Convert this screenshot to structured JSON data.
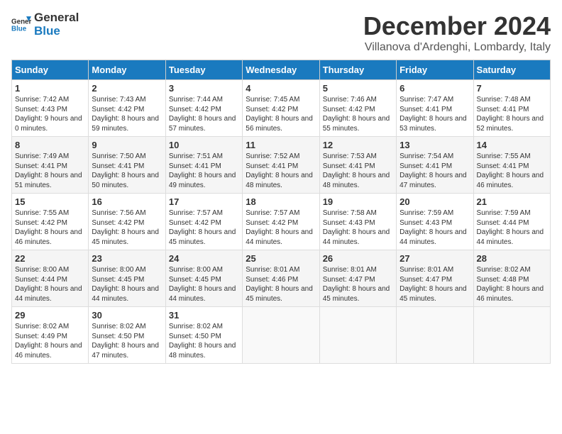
{
  "header": {
    "logo_general": "General",
    "logo_blue": "Blue",
    "title": "December 2024",
    "location": "Villanova d'Ardenghi, Lombardy, Italy"
  },
  "days_of_week": [
    "Sunday",
    "Monday",
    "Tuesday",
    "Wednesday",
    "Thursday",
    "Friday",
    "Saturday"
  ],
  "weeks": [
    [
      {
        "day": "1",
        "sunrise": "7:42 AM",
        "sunset": "4:43 PM",
        "daylight": "9 hours and 0 minutes."
      },
      {
        "day": "2",
        "sunrise": "7:43 AM",
        "sunset": "4:42 PM",
        "daylight": "8 hours and 59 minutes."
      },
      {
        "day": "3",
        "sunrise": "7:44 AM",
        "sunset": "4:42 PM",
        "daylight": "8 hours and 57 minutes."
      },
      {
        "day": "4",
        "sunrise": "7:45 AM",
        "sunset": "4:42 PM",
        "daylight": "8 hours and 56 minutes."
      },
      {
        "day": "5",
        "sunrise": "7:46 AM",
        "sunset": "4:42 PM",
        "daylight": "8 hours and 55 minutes."
      },
      {
        "day": "6",
        "sunrise": "7:47 AM",
        "sunset": "4:41 PM",
        "daylight": "8 hours and 53 minutes."
      },
      {
        "day": "7",
        "sunrise": "7:48 AM",
        "sunset": "4:41 PM",
        "daylight": "8 hours and 52 minutes."
      }
    ],
    [
      {
        "day": "8",
        "sunrise": "7:49 AM",
        "sunset": "4:41 PM",
        "daylight": "8 hours and 51 minutes."
      },
      {
        "day": "9",
        "sunrise": "7:50 AM",
        "sunset": "4:41 PM",
        "daylight": "8 hours and 50 minutes."
      },
      {
        "day": "10",
        "sunrise": "7:51 AM",
        "sunset": "4:41 PM",
        "daylight": "8 hours and 49 minutes."
      },
      {
        "day": "11",
        "sunrise": "7:52 AM",
        "sunset": "4:41 PM",
        "daylight": "8 hours and 48 minutes."
      },
      {
        "day": "12",
        "sunrise": "7:53 AM",
        "sunset": "4:41 PM",
        "daylight": "8 hours and 48 minutes."
      },
      {
        "day": "13",
        "sunrise": "7:54 AM",
        "sunset": "4:41 PM",
        "daylight": "8 hours and 47 minutes."
      },
      {
        "day": "14",
        "sunrise": "7:55 AM",
        "sunset": "4:41 PM",
        "daylight": "8 hours and 46 minutes."
      }
    ],
    [
      {
        "day": "15",
        "sunrise": "7:55 AM",
        "sunset": "4:42 PM",
        "daylight": "8 hours and 46 minutes."
      },
      {
        "day": "16",
        "sunrise": "7:56 AM",
        "sunset": "4:42 PM",
        "daylight": "8 hours and 45 minutes."
      },
      {
        "day": "17",
        "sunrise": "7:57 AM",
        "sunset": "4:42 PM",
        "daylight": "8 hours and 45 minutes."
      },
      {
        "day": "18",
        "sunrise": "7:57 AM",
        "sunset": "4:42 PM",
        "daylight": "8 hours and 44 minutes."
      },
      {
        "day": "19",
        "sunrise": "7:58 AM",
        "sunset": "4:43 PM",
        "daylight": "8 hours and 44 minutes."
      },
      {
        "day": "20",
        "sunrise": "7:59 AM",
        "sunset": "4:43 PM",
        "daylight": "8 hours and 44 minutes."
      },
      {
        "day": "21",
        "sunrise": "7:59 AM",
        "sunset": "4:44 PM",
        "daylight": "8 hours and 44 minutes."
      }
    ],
    [
      {
        "day": "22",
        "sunrise": "8:00 AM",
        "sunset": "4:44 PM",
        "daylight": "8 hours and 44 minutes."
      },
      {
        "day": "23",
        "sunrise": "8:00 AM",
        "sunset": "4:45 PM",
        "daylight": "8 hours and 44 minutes."
      },
      {
        "day": "24",
        "sunrise": "8:00 AM",
        "sunset": "4:45 PM",
        "daylight": "8 hours and 44 minutes."
      },
      {
        "day": "25",
        "sunrise": "8:01 AM",
        "sunset": "4:46 PM",
        "daylight": "8 hours and 45 minutes."
      },
      {
        "day": "26",
        "sunrise": "8:01 AM",
        "sunset": "4:47 PM",
        "daylight": "8 hours and 45 minutes."
      },
      {
        "day": "27",
        "sunrise": "8:01 AM",
        "sunset": "4:47 PM",
        "daylight": "8 hours and 45 minutes."
      },
      {
        "day": "28",
        "sunrise": "8:02 AM",
        "sunset": "4:48 PM",
        "daylight": "8 hours and 46 minutes."
      }
    ],
    [
      {
        "day": "29",
        "sunrise": "8:02 AM",
        "sunset": "4:49 PM",
        "daylight": "8 hours and 46 minutes."
      },
      {
        "day": "30",
        "sunrise": "8:02 AM",
        "sunset": "4:50 PM",
        "daylight": "8 hours and 47 minutes."
      },
      {
        "day": "31",
        "sunrise": "8:02 AM",
        "sunset": "4:50 PM",
        "daylight": "8 hours and 48 minutes."
      },
      null,
      null,
      null,
      null
    ]
  ],
  "labels": {
    "sunrise": "Sunrise:",
    "sunset": "Sunset:",
    "daylight": "Daylight:"
  }
}
